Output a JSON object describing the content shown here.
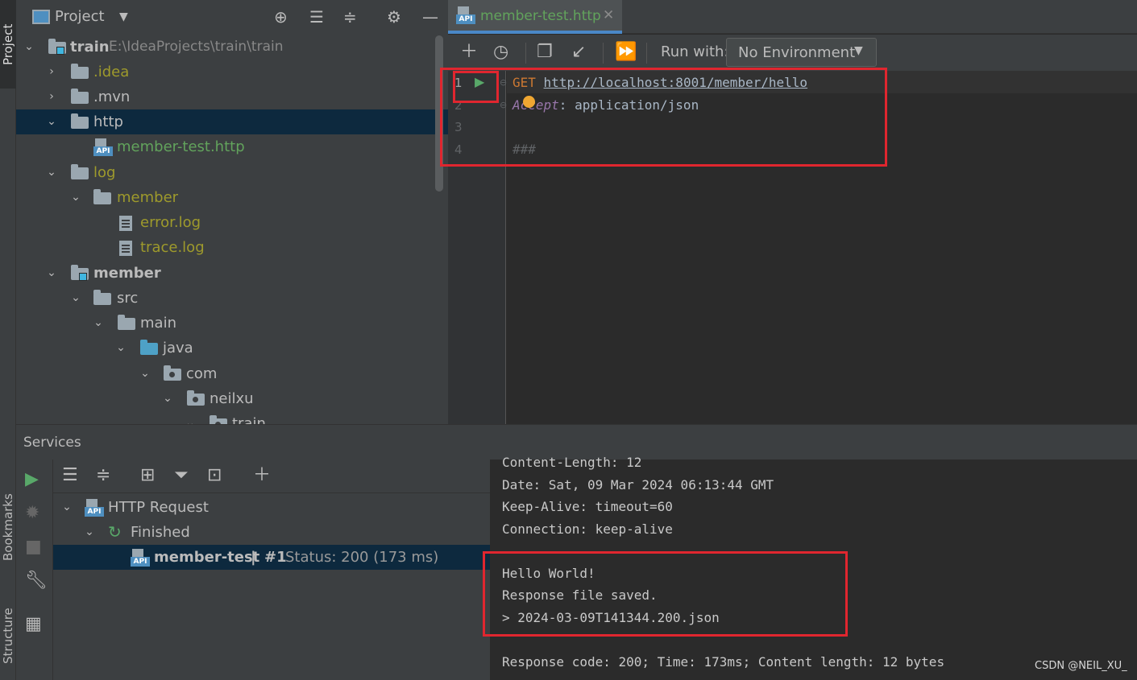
{
  "side_tabs": {
    "project": "Project",
    "bookmarks": "Bookmarks",
    "structure": "Structure"
  },
  "project_panel": {
    "title": "Project",
    "tree": [
      {
        "label": "train",
        "path": "E:\\IdeaProjects\\train\\train"
      },
      {
        "label": ".idea"
      },
      {
        "label": ".mvn"
      },
      {
        "label": "http"
      },
      {
        "label": "member-test.http"
      },
      {
        "label": "log"
      },
      {
        "label": "member"
      },
      {
        "label": "error.log"
      },
      {
        "label": "trace.log"
      },
      {
        "label": "member"
      },
      {
        "label": "src"
      },
      {
        "label": "main"
      },
      {
        "label": "java"
      },
      {
        "label": "com"
      },
      {
        "label": "neilxu"
      },
      {
        "label": "train"
      }
    ]
  },
  "editor": {
    "tab": {
      "label": "member-test.http",
      "close": "✕"
    },
    "toolbar": {
      "run_with_label": "Run with:",
      "environment": "No Environment"
    },
    "line_numbers": [
      "1",
      "2",
      "3",
      "4"
    ],
    "lines": {
      "method": "GET",
      "url": "http://localhost:8001/member/hello",
      "header_name": "Accept",
      "header_sep": ":",
      "header_value": " application/json",
      "separator": "###"
    }
  },
  "services": {
    "title": "Services",
    "tree": {
      "http_request": "HTTP Request",
      "finished": "Finished",
      "item_name": "member-test",
      "item_divider": "|",
      "item_number": "#1",
      "item_status": "Status: 200 (173 ms)"
    },
    "output": [
      "Content-Length: 12",
      "Date: Sat, 09 Mar 2024 06:13:44 GMT",
      "Keep-Alive: timeout=60",
      "Connection: keep-alive",
      "Hello World!",
      "Response file saved.",
      "> 2024-03-09T141344.200.json",
      "Response code: 200; Time: 173ms; Content length: 12 bytes"
    ]
  },
  "watermark": "CSDN @NEIL_XU_"
}
